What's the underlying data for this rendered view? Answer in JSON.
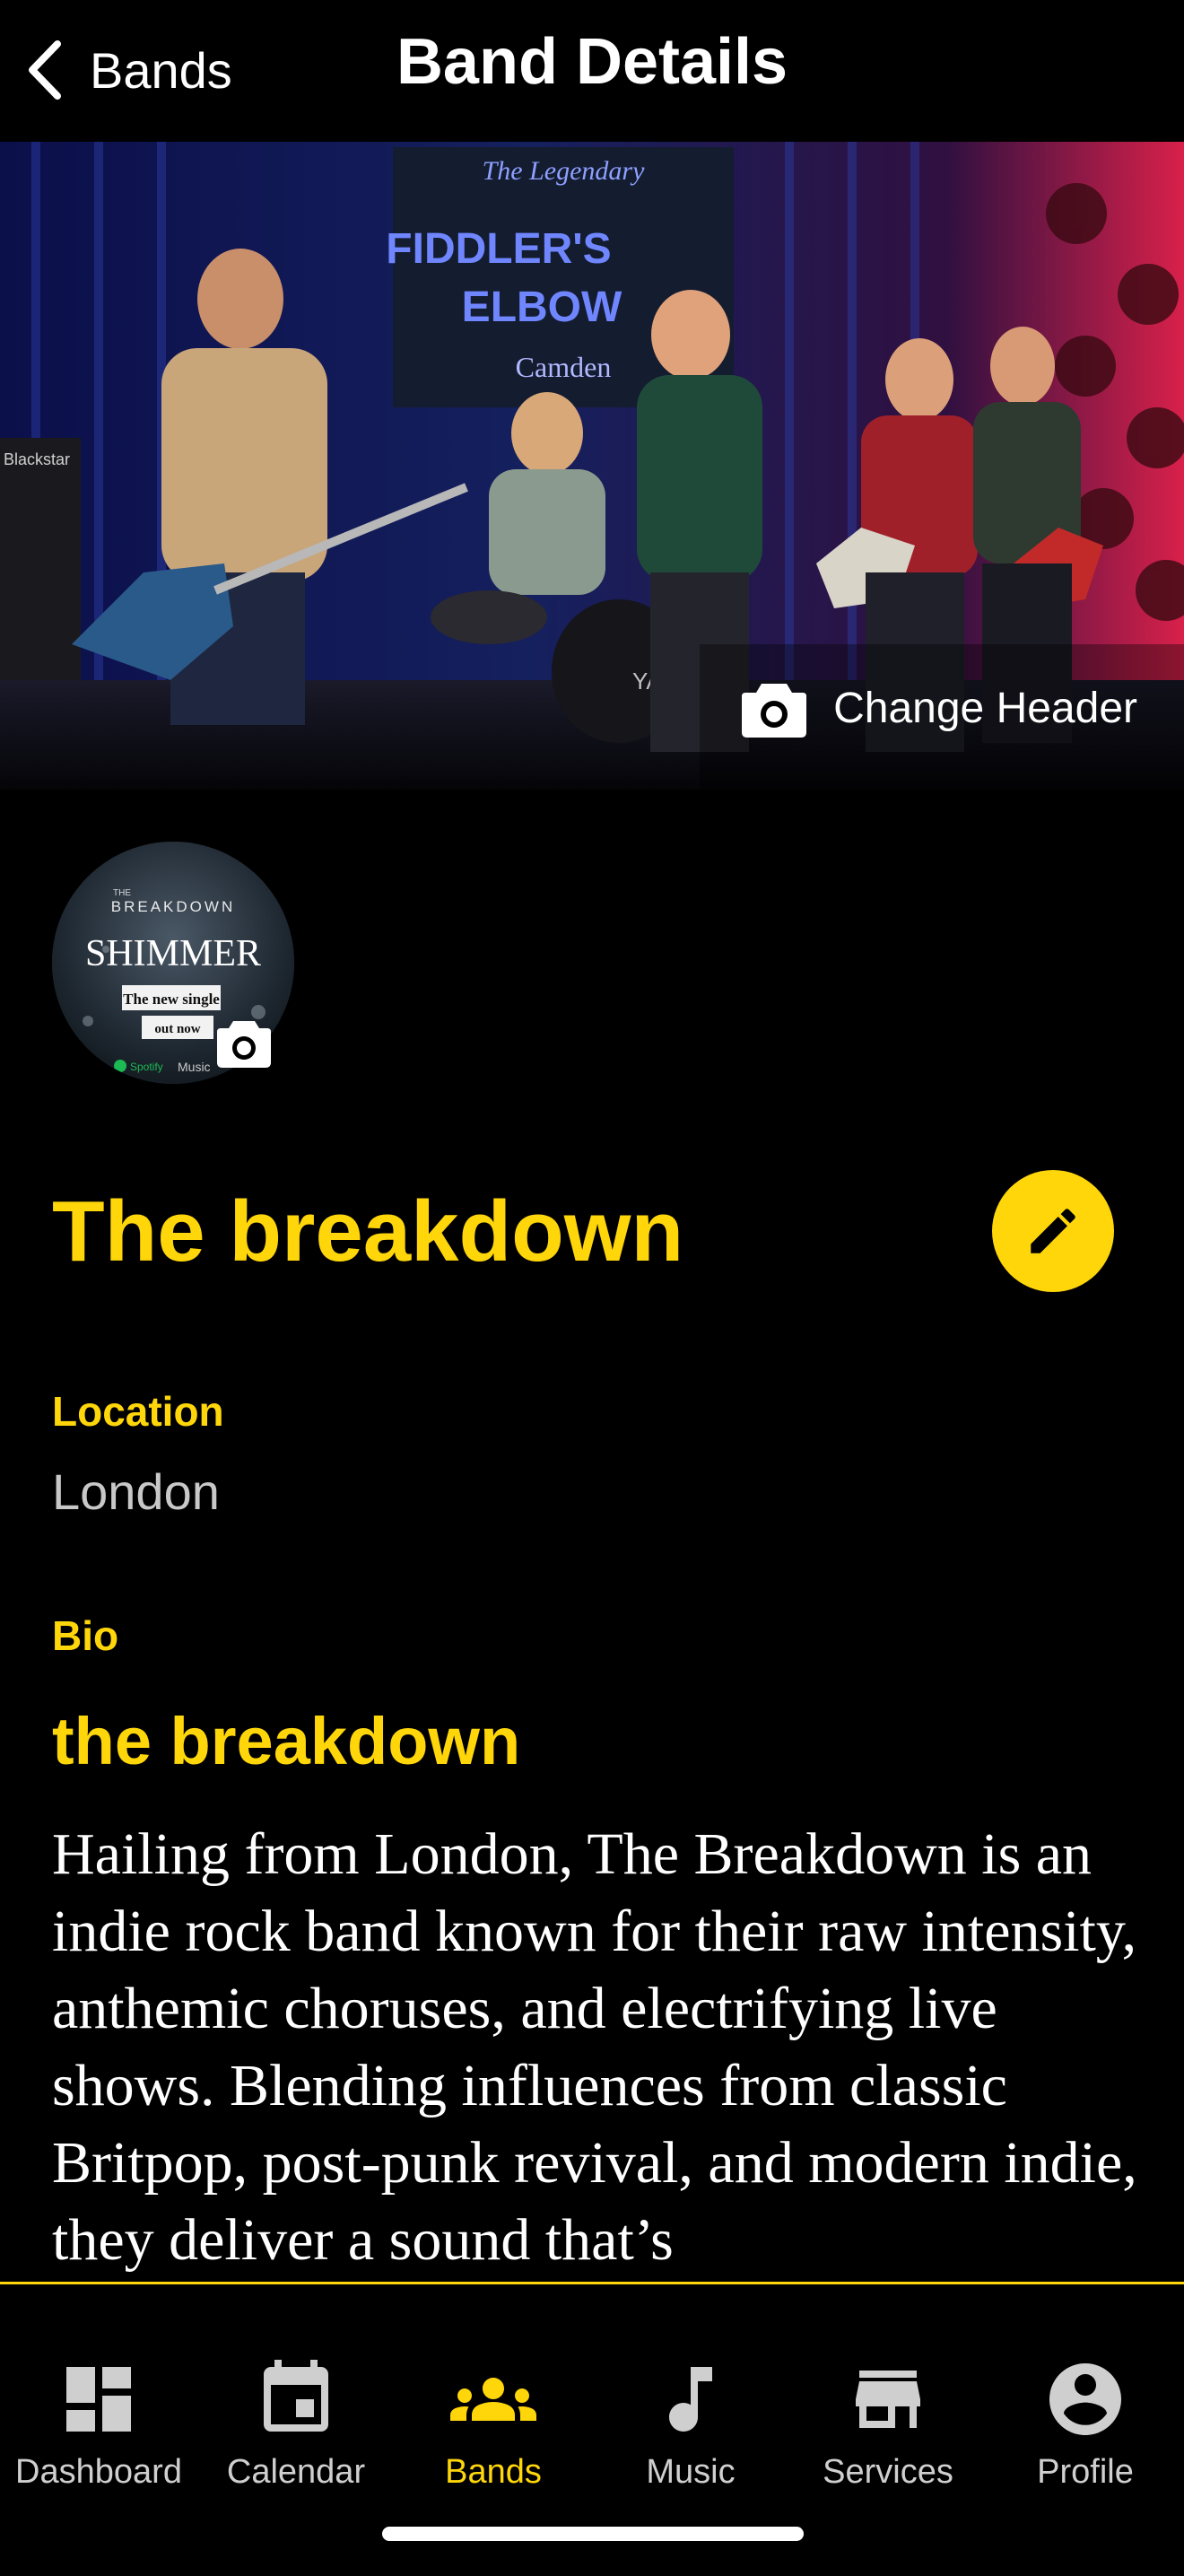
{
  "nav": {
    "back_label": "Bands",
    "title": "Band Details"
  },
  "header": {
    "change_header_label": "Change Header",
    "photo_text": {
      "banner_top": "The Legendary",
      "banner_main_1": "FIDDLER'S",
      "banner_main_2": "ELBOW",
      "banner_sub": "Camden",
      "amp": "Blackstar",
      "drum": "YAMAHA"
    }
  },
  "avatar": {
    "small": "THE",
    "brand": "BREAKDOWN",
    "title": "SHIMMER",
    "line1": "The new single",
    "line2": "out now",
    "service1": "Spotify",
    "service2": "Music"
  },
  "band": {
    "name": "The breakdown",
    "location_label": "Location",
    "location": "London",
    "bio_label": "Bio",
    "bio_heading": "the breakdown",
    "bio": "Hailing from London, The Breakdown is an indie rock band known for their raw intensity, anthemic choruses, and electrifying live shows. Blending influences from classic Britpop, post-punk revival, and modern indie, they deliver a sound that’s"
  },
  "tabs": [
    {
      "label": "Dashboard",
      "icon": "dashboard-icon"
    },
    {
      "label": "Calendar",
      "icon": "calendar-icon"
    },
    {
      "label": "Bands",
      "icon": "bands-icon",
      "active": true
    },
    {
      "label": "Music",
      "icon": "music-icon"
    },
    {
      "label": "Services",
      "icon": "services-icon"
    },
    {
      "label": "Profile",
      "icon": "profile-icon"
    }
  ],
  "colors": {
    "accent": "#FFD60A",
    "background": "#000000",
    "tab_inactive": "#CFCFCF"
  }
}
